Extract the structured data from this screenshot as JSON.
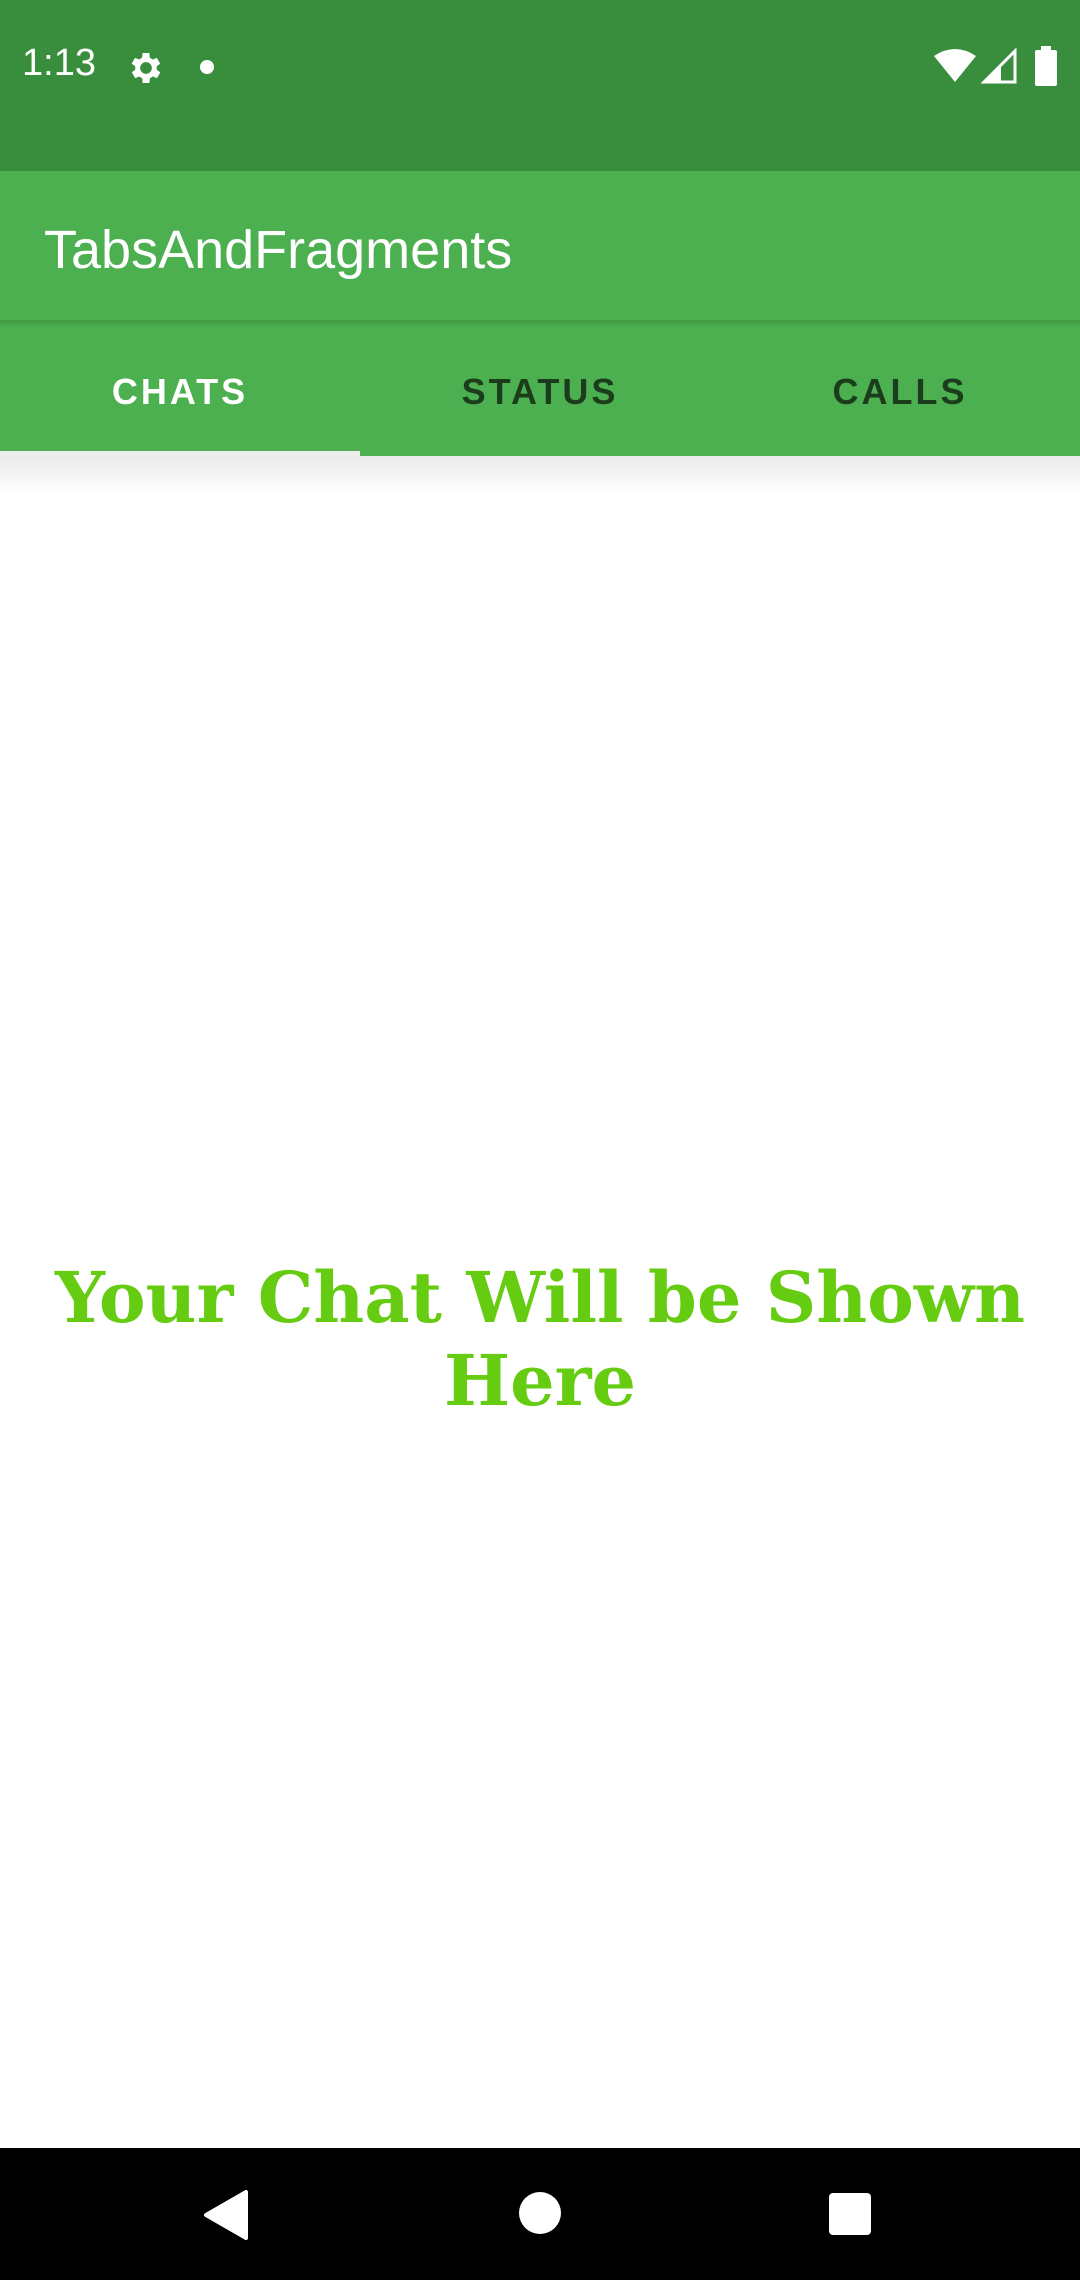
{
  "status_bar": {
    "time": "1:13",
    "icons": [
      "gear-icon",
      "notification-dot-icon",
      "wifi-icon",
      "signal-icon",
      "battery-icon"
    ]
  },
  "app_bar": {
    "title": "TabsAndFragments"
  },
  "tabs": [
    {
      "label": "CHATS",
      "active": true
    },
    {
      "label": "STATUS",
      "active": false
    },
    {
      "label": "CALLS",
      "active": false
    }
  ],
  "content": {
    "placeholder_text": "Your Chat Will be Shown Here"
  },
  "nav_bar": {
    "icons": [
      "back-icon",
      "home-icon",
      "recents-icon"
    ]
  },
  "colors": {
    "status_bar": "#388e3c",
    "primary": "#4caf50",
    "placeholder_text": "#66cc11",
    "inactive_tab": "#1b3d1c",
    "nav_bar": "#000000"
  }
}
